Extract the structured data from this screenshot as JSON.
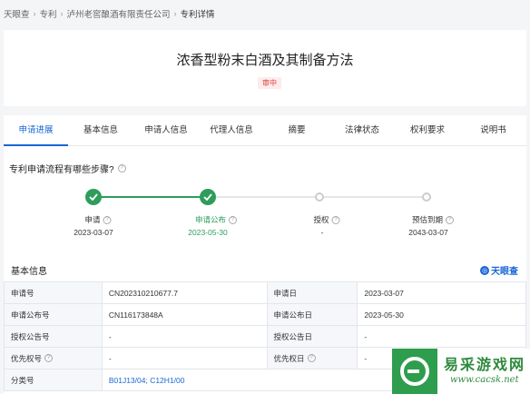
{
  "breadcrumb": {
    "items": [
      "天眼查",
      "专利",
      "泸州老窖酿酒有限责任公司",
      "专利详情"
    ]
  },
  "patent": {
    "title": "浓香型粉末白酒及其制备方法",
    "status": "审中"
  },
  "tabs": [
    {
      "label": "申请进展",
      "active": true
    },
    {
      "label": "基本信息"
    },
    {
      "label": "申请人信息"
    },
    {
      "label": "代理人信息"
    },
    {
      "label": "摘要"
    },
    {
      "label": "法律状态"
    },
    {
      "label": "权利要求"
    },
    {
      "label": "说明书"
    }
  ],
  "progress": {
    "question": "专利申请流程有哪些步骤?",
    "steps": [
      {
        "label": "申请",
        "date": "2023-03-07",
        "done": true
      },
      {
        "label": "申请公布",
        "date": "2023-05-30",
        "done": true
      },
      {
        "label": "授权",
        "date": "-",
        "done": false
      },
      {
        "label": "预估到期",
        "date": "2043-03-07",
        "done": false
      }
    ]
  },
  "basic_info": {
    "heading": "基本信息",
    "brand": "天眼查",
    "rows": [
      {
        "k1": "申请号",
        "v1": "CN202310210677.7",
        "k2": "申请日",
        "v2": "2023-03-07"
      },
      {
        "k1": "申请公布号",
        "v1": "CN116173848A",
        "k2": "申请公布日",
        "v2": "2023-05-30"
      },
      {
        "k1": "授权公告号",
        "v1": "-",
        "k2": "授权公告日",
        "v2": "-"
      },
      {
        "k1": "优先权号",
        "v1": "-",
        "k2": "优先权日",
        "v2": "-"
      },
      {
        "k1": "分类号",
        "v1": "B01J13/04;   C12H1/00",
        "k2": "",
        "v2": ""
      }
    ]
  },
  "watermark": {
    "text": "易采游戏网",
    "url": "www.cacsk.net"
  },
  "colors": {
    "accent": "#1a66d6",
    "done": "#2e9d5b",
    "status": "#e04040"
  }
}
